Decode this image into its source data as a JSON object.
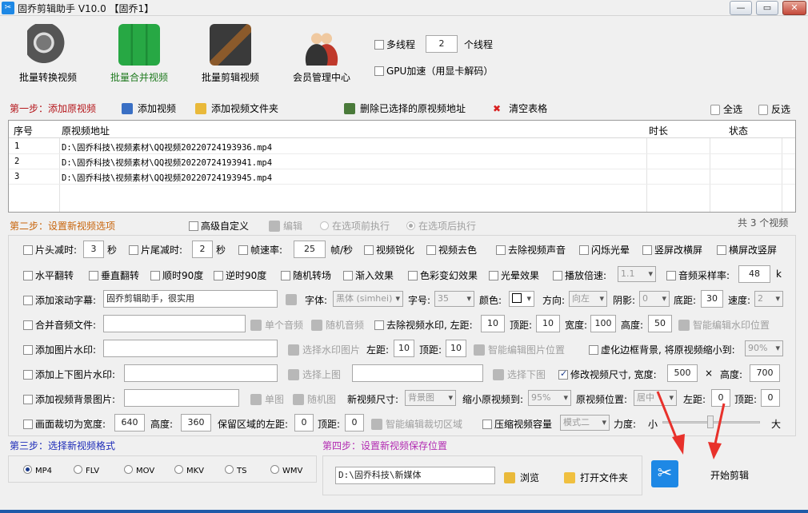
{
  "window": {
    "title": "固乔剪辑助手 V10.0  【固乔1】",
    "btn_min": "—",
    "btn_max": "▭",
    "btn_close": "✕"
  },
  "nav": {
    "items": [
      {
        "label": "批量转换视频",
        "color": "#000000"
      },
      {
        "label": "批量合并视频",
        "color": "#1f7a1f"
      },
      {
        "label": "批量剪辑视频",
        "color": "#000000"
      },
      {
        "label": "会员管理中心",
        "color": "#000000"
      }
    ],
    "multithread_label": "多线程",
    "threads_value": "2",
    "threads_unit": "个线程",
    "gpu_label": "GPU加速（用显卡解码）"
  },
  "step1": {
    "title": "第一步：添加原视频",
    "add_video": "添加视频",
    "add_folder": "添加视频文件夹",
    "delete_selected": "删除已选择的原视频地址",
    "clear_table": "清空表格",
    "select_all": "全选",
    "invert_select": "反选"
  },
  "table": {
    "headers": [
      "序号",
      "原视频地址",
      "时长",
      "状态"
    ],
    "rows": [
      {
        "no": "1",
        "path": "D:\\固乔科技\\视频素材\\QQ视频20220724193936.mp4",
        "duration": "",
        "status": ""
      },
      {
        "no": "2",
        "path": "D:\\固乔科技\\视频素材\\QQ视频20220724193941.mp4",
        "duration": "",
        "status": ""
      },
      {
        "no": "3",
        "path": "D:\\固乔科技\\视频素材\\QQ视频20220724193945.mp4",
        "duration": "",
        "status": ""
      }
    ]
  },
  "step2": {
    "title": "第二步：设置新视频选项",
    "advanced": "高级自定义",
    "edit": "编辑",
    "before": "在选项前执行",
    "after": "在选项后执行",
    "count": "共 3 个视频"
  },
  "row1": {
    "head_cut": "片头减时:",
    "head_val": "3",
    "sec": "秒",
    "tail_cut": "片尾减时:",
    "tail_val": "2",
    "sec2": "秒",
    "fps": "帧速率:",
    "fps_val": "25",
    "fps_unit": "帧/秒",
    "sharpen": "视频锐化",
    "gray": "视频去色",
    "mute": "去除视频声音",
    "flash": "闪烁光晕",
    "v2h": "竖屏改横屏",
    "h2v": "横屏改竖屏"
  },
  "row2": {
    "hflip": "水平翻转",
    "vflip": "垂直翻转",
    "cw90": "顺时90度",
    "ccw90": "逆时90度",
    "rand_trans": "随机转场",
    "fadein": "渐入效果",
    "color_fx": "色彩变幻效果",
    "halo": "光晕效果",
    "speed": "播放倍速:",
    "speed_val": "1.1",
    "samplerate": "音频采样率:",
    "samplerate_val": "48",
    "k": "k"
  },
  "row3": {
    "scroll": "添加滚动字幕:",
    "scroll_text": "固乔剪辑助手，很实用",
    "font": "字体:",
    "font_val": "黑体 (simhei)",
    "size": "字号:",
    "size_val": "35",
    "color": "颜色:",
    "dir": "方向:",
    "dir_val": "向左",
    "shadow": "阴影:",
    "shadow_val": "0",
    "bottom": "底距:",
    "bottom_val": "30",
    "speed": "速度:",
    "speed_val": "2"
  },
  "row4": {
    "merge_audio": "合并音频文件:",
    "single_audio": "单个音频",
    "random_audio": "随机音频",
    "remove_wm": "去除视频水印, 左距:",
    "left_val": "10",
    "top": "顶距:",
    "top_val": "10",
    "width": "宽度:",
    "width_val": "100",
    "height": "高度:",
    "height_val": "50",
    "smart_wm": "智能编辑水印位置"
  },
  "row5": {
    "img_wm": "添加图片水印:",
    "choose_wm": "选择水印图片",
    "left": "左距:",
    "left_val": "10",
    "top": "顶距:",
    "top_val": "10",
    "smart_img": "智能编辑图片位置",
    "blur_bg": "虚化边框背景, 将原视频缩小到:",
    "blur_val": "90%"
  },
  "row6": {
    "tb_img": "添加上下图片水印:",
    "choose_top": "选择上图",
    "choose_bottom": "选择下图",
    "resize": "修改视频尺寸, 宽度:",
    "w_val": "500",
    "x": "×",
    "h": "高度:",
    "h_val": "700"
  },
  "row7": {
    "bg_img": "添加视频背景图片:",
    "single": "单图",
    "random": "随机图",
    "new_size": "新视频尺寸:",
    "new_size_val": "背景图",
    "shrink": "缩小原视频到:",
    "shrink_val": "95%",
    "pos": "原视频位置:",
    "pos_val": "居中",
    "left": "左距:",
    "left_val": "0",
    "top": "顶距:",
    "top_val": "0"
  },
  "row8": {
    "crop": "画面裁切为宽度:",
    "w_val": "640",
    "h": "高度:",
    "h_val": "360",
    "keep_left": "保留区域的左距:",
    "left_val": "0",
    "top": "顶距:",
    "top_val": "0",
    "smart_crop": "智能编辑裁切区域",
    "compress": "压缩视频容量",
    "mode_val": "模式二",
    "strength": "力度:",
    "small": "小",
    "big": "大"
  },
  "step3": {
    "title": "第三步：选择新视频格式",
    "formats": [
      "MP4",
      "FLV",
      "MOV",
      "MKV",
      "TS",
      "WMV"
    ]
  },
  "step4": {
    "title": "第四步：设置新视频保存位置",
    "path": "D:\\固乔科技\\新媒体",
    "browse": "浏览",
    "open_folder": "打开文件夹"
  },
  "start": {
    "label": "开始剪辑"
  },
  "colors": {
    "accent": "#1e88e5",
    "arrow": "#e8312b"
  }
}
